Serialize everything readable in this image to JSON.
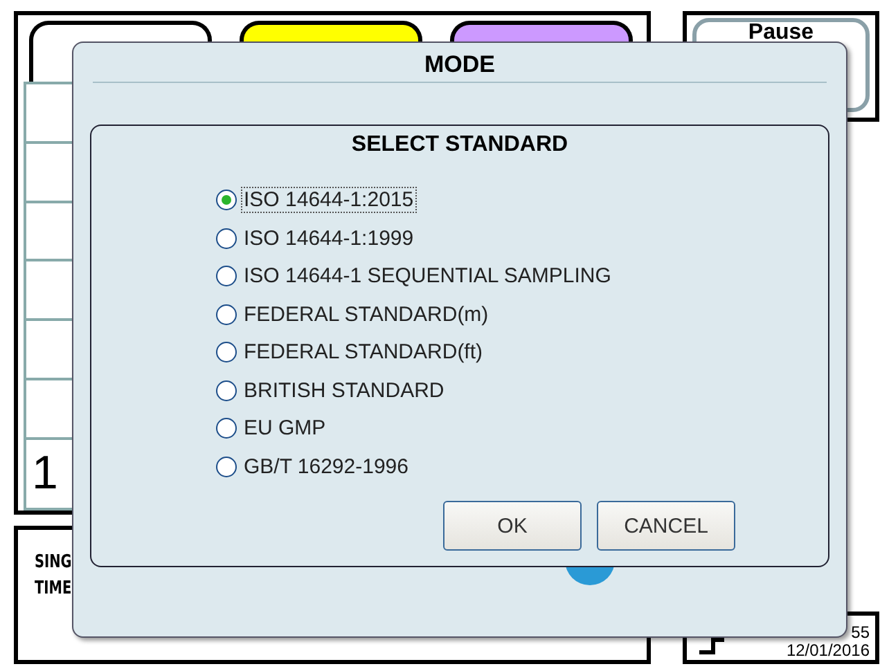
{
  "background": {
    "tabs": [
      {
        "color": "#ffffff"
      },
      {
        "color": "#ffff00"
      },
      {
        "color": "#cc99ff"
      }
    ],
    "pause_button": "Pause",
    "grid_value": "1",
    "info_lines": [
      "SING",
      "TIME"
    ],
    "status_time": "55",
    "status_date": "12/01/2016"
  },
  "dialog": {
    "title": "MODE",
    "panel_title": "SELECT STANDARD",
    "options": [
      {
        "label": "ISO 14644-1:2015",
        "selected": true
      },
      {
        "label": "ISO 14644-1:1999",
        "selected": false
      },
      {
        "label": "ISO 14644-1 SEQUENTIAL SAMPLING",
        "selected": false
      },
      {
        "label": "FEDERAL STANDARD(m)",
        "selected": false
      },
      {
        "label": "FEDERAL STANDARD(ft)",
        "selected": false
      },
      {
        "label": "BRITISH STANDARD",
        "selected": false
      },
      {
        "label": "EU GMP",
        "selected": false
      },
      {
        "label": "GB/T 16292-1996",
        "selected": false
      }
    ],
    "buttons": [
      "OK",
      "CANCEL"
    ]
  }
}
